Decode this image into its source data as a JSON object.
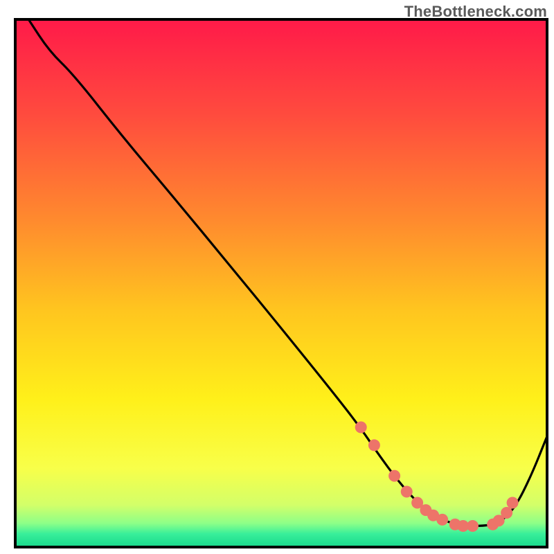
{
  "watermark": "TheBottleneck.com",
  "colors": {
    "border": "#000000",
    "curve": "#000000",
    "marker_fill": "#ed7469",
    "marker_stroke": "#ed7469",
    "gradient_stops": [
      {
        "offset": 0.0,
        "color": "#ff1a49"
      },
      {
        "offset": 0.18,
        "color": "#ff4b3e"
      },
      {
        "offset": 0.38,
        "color": "#ff8a2e"
      },
      {
        "offset": 0.55,
        "color": "#ffc51f"
      },
      {
        "offset": 0.72,
        "color": "#fff01a"
      },
      {
        "offset": 0.85,
        "color": "#f8ff49"
      },
      {
        "offset": 0.92,
        "color": "#d3ff69"
      },
      {
        "offset": 0.955,
        "color": "#8dff88"
      },
      {
        "offset": 0.975,
        "color": "#38ef9a"
      },
      {
        "offset": 1.0,
        "color": "#18d88c"
      }
    ]
  },
  "chart_data": {
    "type": "line",
    "title": "",
    "xlabel": "",
    "ylabel": "",
    "xlim": [
      0,
      100
    ],
    "ylim": [
      0,
      100
    ],
    "note": "Axis values are estimated from pixel positions; no tick labels are drawn in the image.",
    "series": [
      {
        "name": "bottleneck-curve",
        "x": [
          2.5,
          6.4,
          11.0,
          20.0,
          30.0,
          40.0,
          50.0,
          60.0,
          65.0,
          68.0,
          72.0,
          76.0,
          80.0,
          84.0,
          88.0,
          91.0,
          94.0,
          97.0,
          100.0
        ],
        "y": [
          100.0,
          94.0,
          89.5,
          78.0,
          66.0,
          53.8,
          41.5,
          29.0,
          22.5,
          18.0,
          12.5,
          8.0,
          5.2,
          4.0,
          4.0,
          4.5,
          7.5,
          13.5,
          21.0
        ]
      }
    ],
    "markers": {
      "name": "highlighted-points",
      "x": [
        65.0,
        67.5,
        71.3,
        73.6,
        75.6,
        77.2,
        78.6,
        80.3,
        82.7,
        84.2,
        86.0,
        89.8,
        90.9,
        92.4,
        93.5
      ],
      "y": [
        22.7,
        19.3,
        13.5,
        10.5,
        8.4,
        7.0,
        6.0,
        5.2,
        4.3,
        4.0,
        4.0,
        4.3,
        5.0,
        6.5,
        8.4
      ]
    }
  }
}
